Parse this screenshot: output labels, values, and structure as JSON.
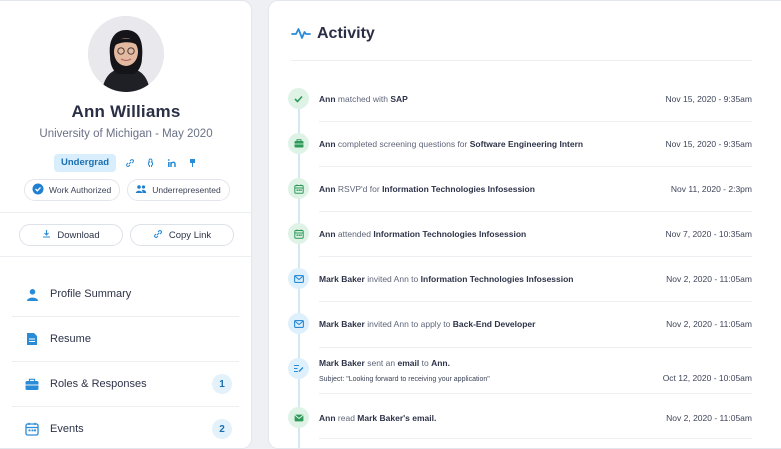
{
  "profile": {
    "name": "Ann Williams",
    "school": "University of Michigan - May 2020",
    "tag": "Undergrad",
    "badges": [
      "Work Authorized",
      "Underrepresented"
    ]
  },
  "actions": {
    "download": "Download",
    "copy_link": "Copy Link"
  },
  "nav": [
    {
      "label": "Profile Summary",
      "icon": "person-icon"
    },
    {
      "label": "Resume",
      "icon": "document-icon"
    },
    {
      "label": "Roles & Responses",
      "icon": "briefcase-icon",
      "count": "1"
    },
    {
      "label": "Events",
      "icon": "calendar-icon",
      "count": "2"
    }
  ],
  "activity": {
    "title": "Activity",
    "items": [
      {
        "icon": "check-icon",
        "actor": "Ann",
        "verb": "matched with",
        "object": "SAP",
        "date": "Nov 15, 2020 - 9:35am"
      },
      {
        "icon": "briefcase-icon",
        "actor": "Ann",
        "verb": "completed screening questions for",
        "object": "Software Engineering Intern",
        "date": "Nov 15, 2020 - 9:35am"
      },
      {
        "icon": "calendar-icon",
        "actor": "Ann",
        "verb": "RSVP'd for",
        "object": "Information Technologies Infosession",
        "date": "Nov 11, 2020 - 2:3pm"
      },
      {
        "icon": "calendar-icon",
        "actor": "Ann",
        "verb": "attended",
        "object": "Information Technologies Infosession",
        "date": "Nov 7, 2020 - 10:35am"
      },
      {
        "icon": "mail-icon",
        "actor": "Mark Baker",
        "verb": "invited Ann to",
        "object": "Information Technologies Infosession",
        "date": "Nov 2, 2020 - 11:05am"
      },
      {
        "icon": "mail-icon",
        "actor": "Mark Baker",
        "verb": "invited Ann to apply to",
        "object": "Back-End Developer",
        "date": "Nov 2, 2020 - 11:05am"
      },
      {
        "icon": "compose-icon",
        "actor": "Mark Baker",
        "verb": "sent an",
        "object": "email",
        "verb2": "to",
        "object2": "Ann.",
        "subject": "Subject: \"Looking forward to receiving your application\"",
        "date": "Oct  12, 2020 - 10:05am"
      },
      {
        "icon": "mail-open-icon",
        "actor": "Ann",
        "verb": "read",
        "object": "Mark Baker's email.",
        "date": "Nov 2, 2020 - 11:05am"
      }
    ]
  },
  "colors": {
    "accent": "#2a8cd6",
    "green": "#2e9a5a",
    "text": "#2d3348"
  }
}
